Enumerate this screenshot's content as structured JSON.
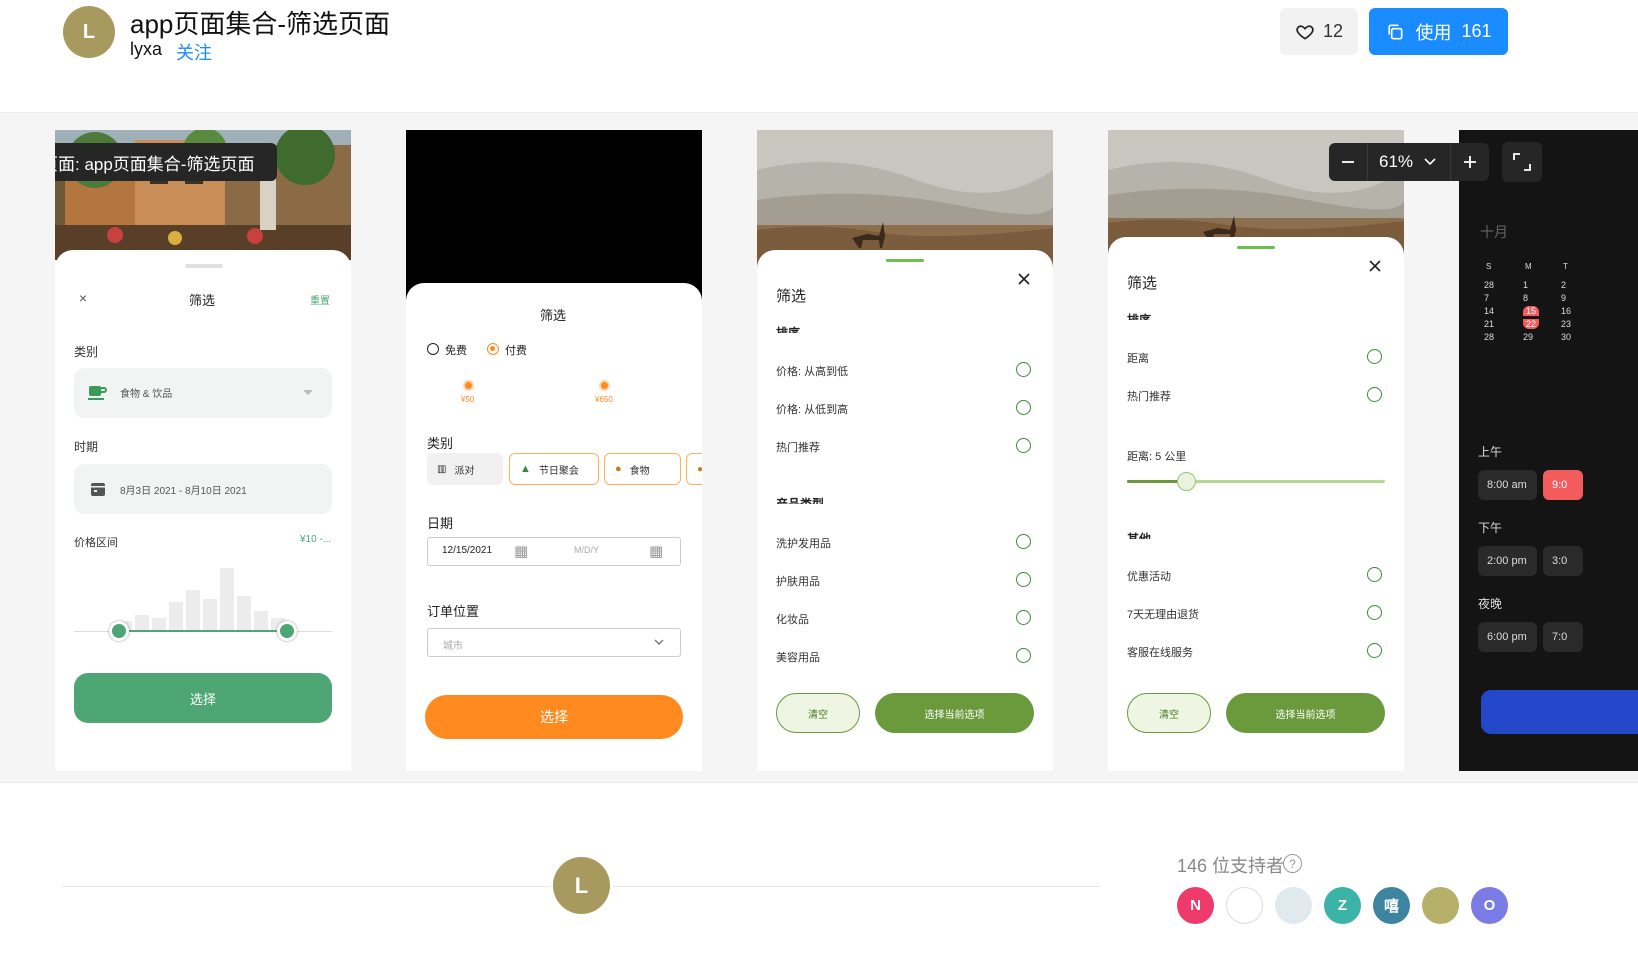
{
  "header": {
    "title": "app页面集合-筛选页面",
    "author": "lyxa",
    "avatar_letter": "L",
    "follow_label": "关注",
    "like_count": "12",
    "use_label": "使用",
    "use_count": "161"
  },
  "canvas": {
    "page_label": "页面: app页面集合-筛选页面",
    "zoom_level": "61%",
    "zoom_out_icon": "minus-icon",
    "zoom_in_icon": "plus-icon",
    "fullscreen_icon": "expand-icon"
  },
  "screen1": {
    "close": "×",
    "title": "筛选",
    "reset": "重置",
    "category_label": "类别",
    "category_value": "食物 & 饮品",
    "period_label": "时期",
    "period_value": "8月3日 2021 - 8月10日 2021",
    "price_label": "价格区间",
    "price_value": "¥10 -...",
    "histogram": [
      0.15,
      0.25,
      0.2,
      0.45,
      0.65,
      0.5,
      1.0,
      0.55,
      0.3,
      0.2
    ],
    "select_button": "选择",
    "accent": "#4ea674"
  },
  "screen2": {
    "title": "筛选",
    "free": "免费",
    "paid": "付费",
    "price_min": "¥50",
    "price_max": "¥650",
    "category_label": "类别",
    "chips": [
      "派对",
      "节日聚会",
      "食物"
    ],
    "date_label": "日期",
    "date_from": "12/15/2021",
    "date_to_placeholder": "M/D/Y",
    "location_label": "订单位置",
    "city_placeholder": "城市",
    "select_button": "选择",
    "accent": "#ff8a1f"
  },
  "screen3": {
    "title": "筛选",
    "sort_heading": "排序",
    "sort_options": [
      "价格: 从高到低",
      "价格: 从低到高",
      "热门推荐"
    ],
    "product_heading": "产品类型",
    "product_options": [
      "洗护发用品",
      "护肤用品",
      "化妆品",
      "美容用品"
    ],
    "clear_button": "清空",
    "apply_button": "选择当前选项",
    "accent": "#6b9a3c"
  },
  "screen4": {
    "title": "筛选",
    "sort_heading": "排序",
    "sort_options": [
      "距离",
      "热门推荐"
    ],
    "distance_label": "距离:  5 公里",
    "distance_fraction": 0.23,
    "other_heading": "其他",
    "other_options": [
      "优惠活动",
      "7天无理由退货",
      "客服在线服务"
    ],
    "clear_button": "清空",
    "apply_button": "选择当前选项"
  },
  "screen5": {
    "month": "十月",
    "weekdays": [
      "S",
      "M",
      "T"
    ],
    "days": [
      [
        "28",
        "1",
        "2"
      ],
      [
        "7",
        "8",
        "9"
      ],
      [
        "14",
        "15",
        "16"
      ],
      [
        "21",
        "22",
        "23"
      ],
      [
        "28",
        "29",
        "30"
      ]
    ],
    "morning": "上午",
    "afternoon": "下午",
    "evening": "夜晚",
    "times": [
      "8:00 am",
      "9:0",
      "2:00 pm",
      "3:0",
      "6:00 pm",
      "7:0"
    ]
  },
  "footer": {
    "supporters": "146 位支持者",
    "supporter_avatars": [
      {
        "letter": "N",
        "color": "#ee3b6b"
      },
      {
        "letter": "",
        "color": "#ffffff"
      },
      {
        "letter": "",
        "color": "#dfe9ee"
      },
      {
        "letter": "Z",
        "color": "#3bb3a7"
      },
      {
        "letter": "嘻",
        "color": "#3d84a0"
      },
      {
        "letter": "",
        "color": "#b7b06a"
      },
      {
        "letter": "O",
        "color": "#7b7be6"
      }
    ]
  }
}
